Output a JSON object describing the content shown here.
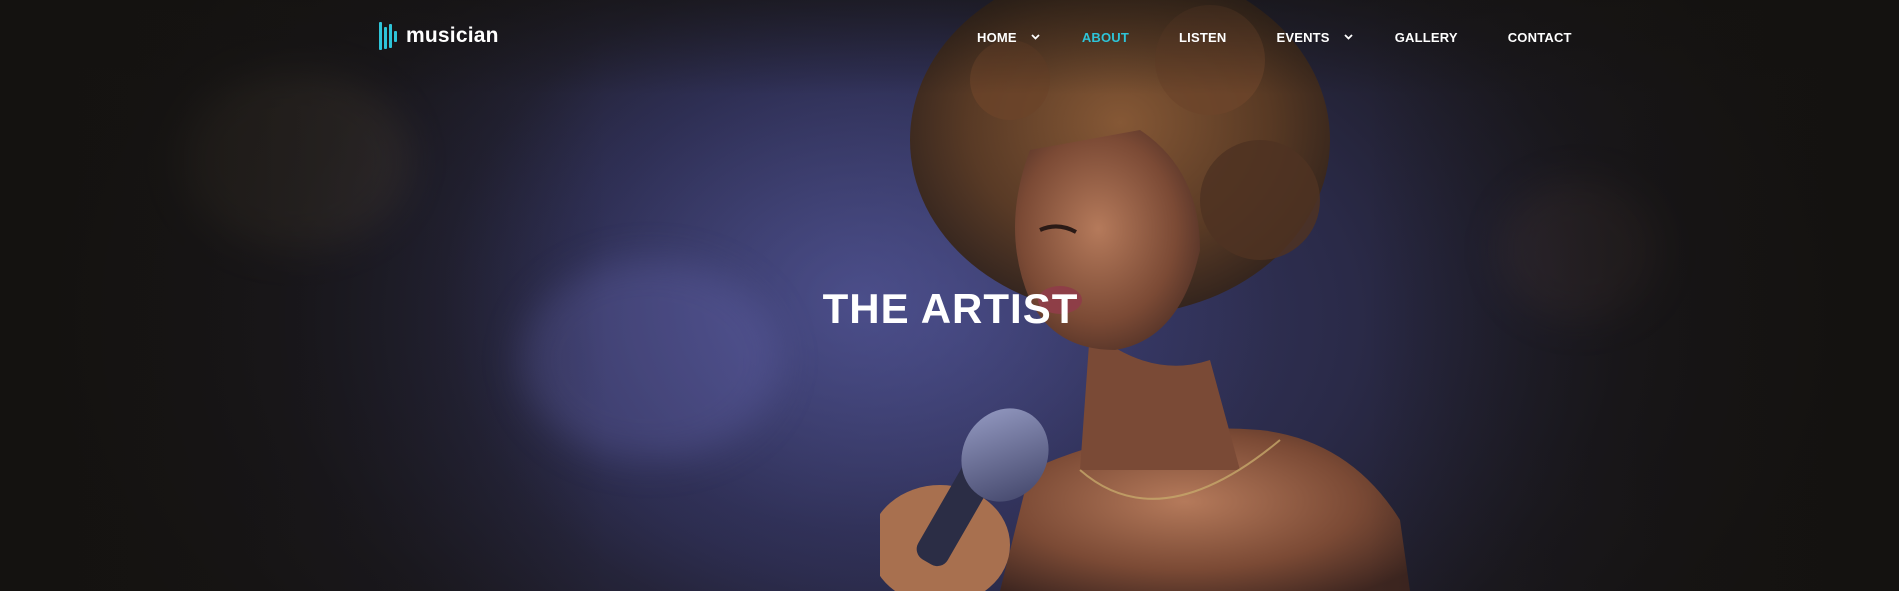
{
  "brand": {
    "name": "musician",
    "logo_icon": "equalizer-bars-icon",
    "accent_color": "#2ec4d8"
  },
  "nav": {
    "items": [
      {
        "label": "HOME",
        "has_dropdown": true,
        "active": false
      },
      {
        "label": "ABOUT",
        "has_dropdown": false,
        "active": true
      },
      {
        "label": "LISTEN",
        "has_dropdown": false,
        "active": false
      },
      {
        "label": "EVENTS",
        "has_dropdown": true,
        "active": false
      },
      {
        "label": "GALLERY",
        "has_dropdown": false,
        "active": false
      },
      {
        "label": "CONTACT",
        "has_dropdown": false,
        "active": false
      }
    ],
    "text_color": "#ffffff",
    "active_color": "#2ec4d8"
  },
  "hero": {
    "title": "THE ARTIST",
    "image": "singer-with-microphone"
  }
}
